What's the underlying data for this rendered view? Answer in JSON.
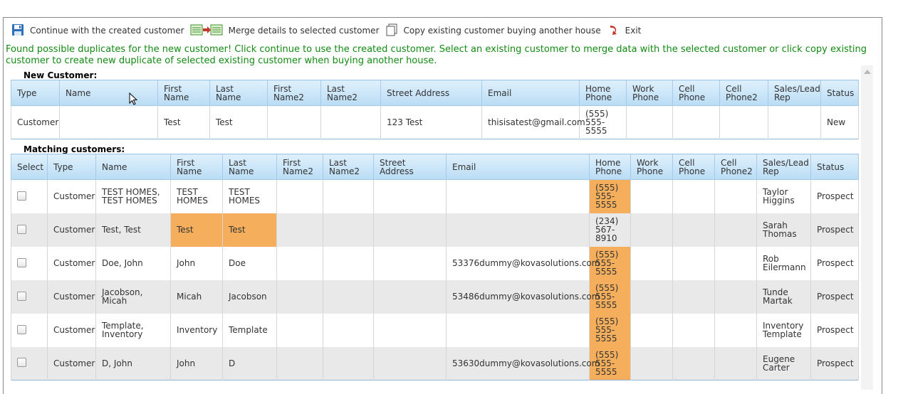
{
  "toolbar": {
    "continue_label": "Continue with the created customer",
    "merge_label": "Merge details to selected customer",
    "copy_label": "Copy existing customer buying another house",
    "exit_label": "Exit"
  },
  "message": "Found possible duplicates for the new customer! Click continue to use the created customer. Select an existing customer to merge data with the selected customer or click copy existing customer to create new duplicate of selected existing customer when buying another house.",
  "new_customer": {
    "label": "New Customer:",
    "headers": [
      "Type",
      "Name",
      "First Name",
      "Last Name",
      "First Name2",
      "Last Name2",
      "Street Address",
      "Email",
      "Home Phone",
      "Work Phone",
      "Cell Phone",
      "Cell Phone2",
      "Sales/Lead Rep",
      "Status"
    ],
    "row": [
      "Customer",
      "",
      "Test",
      "Test",
      "",
      "",
      "123 Test",
      "thisisatest@gmail.com",
      "(555) 555-5555",
      "",
      "",
      "",
      "",
      "New"
    ]
  },
  "matching": {
    "label": "Matching customers:",
    "headers": [
      "Select",
      "Type",
      "Name",
      "First Name",
      "Last Name",
      "First Name2",
      "Last Name2",
      "Street Address",
      "Email",
      "Home Phone",
      "Work Phone",
      "Cell Phone",
      "Cell Phone2",
      "Sales/Lead Rep",
      "Status"
    ],
    "rows": [
      {
        "cells": [
          "",
          "Customer",
          "TEST HOMES, TEST HOMES",
          "TEST HOMES",
          "TEST HOMES",
          "",
          "",
          "",
          "",
          "(555) 555-5555",
          "",
          "",
          "",
          "Taylor Higgins",
          "Prospect"
        ],
        "hl": [
          9
        ]
      },
      {
        "cells": [
          "",
          "Customer",
          "Test, Test",
          "Test",
          "Test",
          "",
          "",
          "",
          "",
          "(234) 567-8910",
          "",
          "",
          "",
          "Sarah Thomas",
          "Prospect"
        ],
        "hl": [
          3,
          4
        ]
      },
      {
        "cells": [
          "",
          "Customer",
          "Doe, John",
          "John",
          "Doe",
          "",
          "",
          "",
          "53376dummy@kovasolutions.com",
          "(555) 555-5555",
          "",
          "",
          "",
          "Rob Eilermann",
          "Prospect"
        ],
        "hl": [
          9
        ]
      },
      {
        "cells": [
          "",
          "Customer",
          "Jacobson, Micah",
          "Micah",
          "Jacobson",
          "",
          "",
          "",
          "53486dummy@kovasolutions.com",
          "(555) 555-5555",
          "",
          "",
          "",
          "Tunde Martak",
          "Prospect"
        ],
        "hl": [
          9
        ]
      },
      {
        "cells": [
          "",
          "Customer",
          "Template, Inventory",
          "Inventory",
          "Template",
          "",
          "",
          "",
          "",
          "(555) 555-5555",
          "",
          "",
          "",
          "Inventory Template",
          "Prospect"
        ],
        "hl": [
          9
        ]
      },
      {
        "cells": [
          "",
          "Customer",
          "D, John",
          "John",
          "D",
          "",
          "",
          "",
          "53630dummy@kovasolutions.com",
          "(555) 555-5555",
          "",
          "",
          "",
          "Eugene Carter",
          "Prospect"
        ],
        "hl": [
          9
        ]
      }
    ]
  },
  "colors": {
    "message_green": "#128a12",
    "highlight_orange": "#f5af5c",
    "header_blue": "#b9dcf5"
  },
  "icons": [
    "save-icon",
    "merge-icon",
    "copy-icon",
    "exit-icon"
  ]
}
